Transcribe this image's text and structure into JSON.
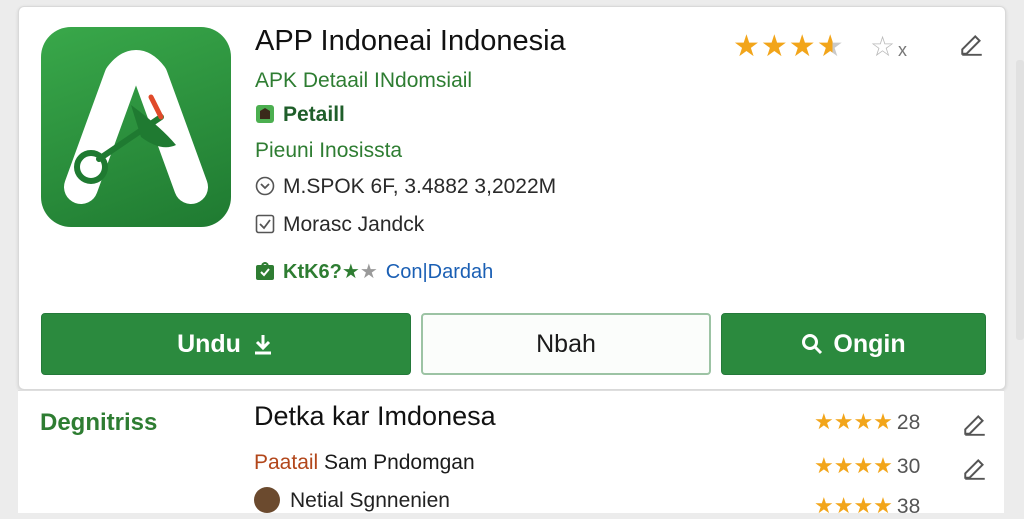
{
  "app": {
    "title": "APP Indoneai Indonesia",
    "subtitle": "APK Detaail INdomsiail",
    "category": "Petaill",
    "publisher": "Pieuni Inosissta",
    "meta": "M.SPOK 6F, 3.4882 3,2022M",
    "rating_text": "Morasc Jandck",
    "badge_text": "KtK6?",
    "badge_link": "Con|Dardah",
    "rating_stars": 4.5,
    "rating_x": "x"
  },
  "buttons": {
    "download": "Undu",
    "middle": "Nbah",
    "search": "Ongin"
  },
  "section": {
    "label": "Degnitriss",
    "items": [
      {
        "title": "Detka kar Imdonesa",
        "count": "28"
      },
      {
        "subtitle_brand": "Paatail",
        "subtitle_rest": " Sam Pndomgan",
        "count": "30"
      },
      {
        "third": "Netial Sgnnenien",
        "count": "38"
      }
    ]
  },
  "colors": {
    "brand_green": "#2b8a3e",
    "star_gold": "#f2a51a",
    "link_blue": "#1a5fb4"
  }
}
